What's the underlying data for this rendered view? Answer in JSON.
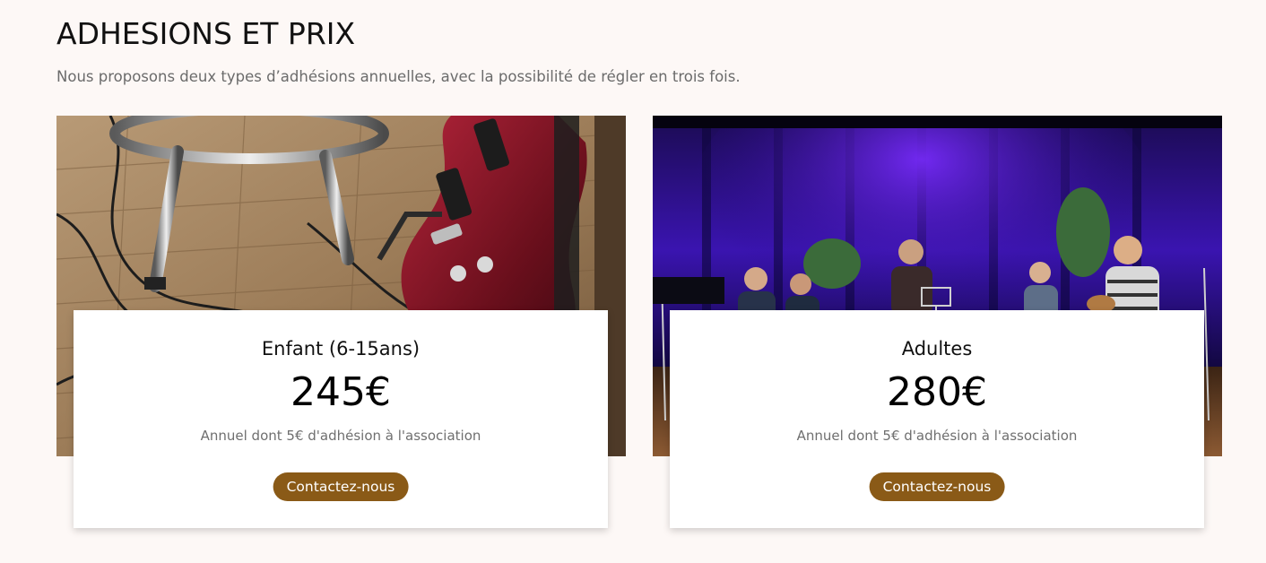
{
  "section": {
    "title": "ADHESIONS ET PRIX",
    "subtitle": "Nous proposons deux types d’adhésions annuelles, avec la possibilité de régler en trois fois."
  },
  "plans": [
    {
      "name": "Enfant (6-15ans)",
      "price": "245€",
      "note": "Annuel dont 5€ d'adhésion à l'association",
      "button_label": "Contactez-nous",
      "image_icon": "guitar-photo"
    },
    {
      "name": "Adultes",
      "price": "280€",
      "note": "Annuel dont 5€ d'adhésion à l'association",
      "button_label": "Contactez-nous",
      "image_icon": "concert-stage-photo"
    }
  ],
  "colors": {
    "background": "#fdf8f6",
    "button": "#8a5a17",
    "button_text": "#ffffff",
    "card": "#ffffff"
  }
}
